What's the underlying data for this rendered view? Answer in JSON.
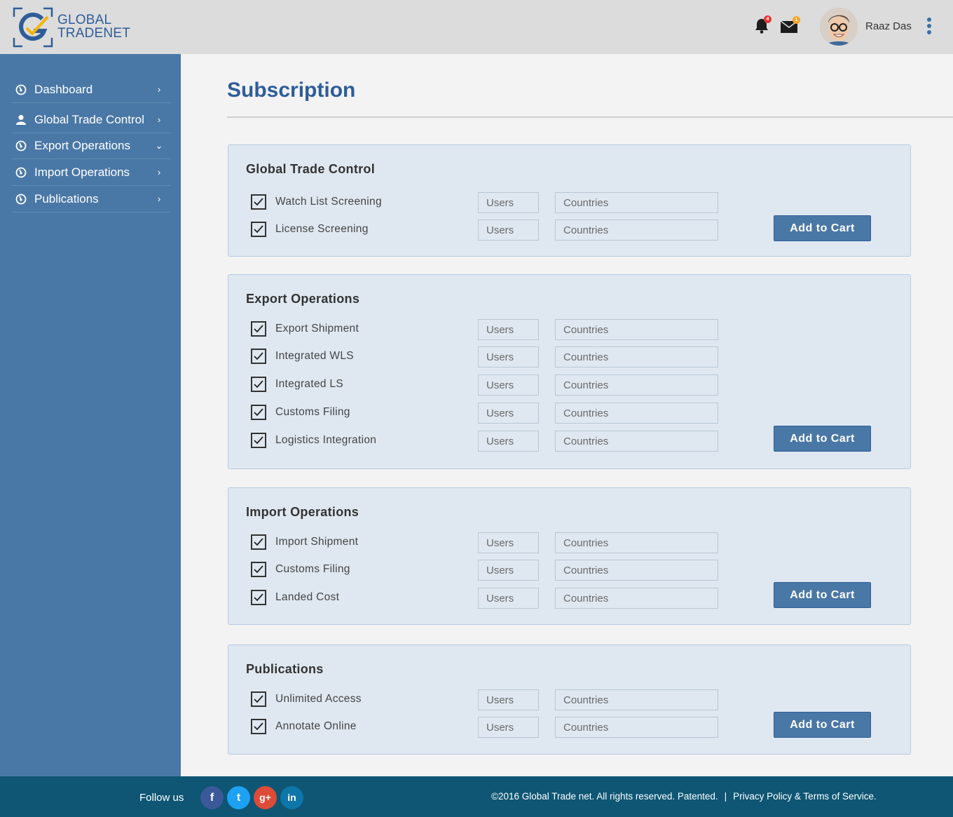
{
  "brand": {
    "line1": "GLOBAL",
    "line2": "TRADENET"
  },
  "header": {
    "notifications": {
      "icon": "bell-icon",
      "count": "4",
      "badge_color": "#e53935"
    },
    "messages": {
      "icon": "mail-icon",
      "count": "1",
      "badge_color": "#f5a623"
    },
    "user_name": "Raaz Das"
  },
  "sidebar": {
    "items": [
      {
        "label": "Dashboard",
        "icon": "dashboard-icon",
        "chevron": "›"
      },
      {
        "label": "Global Trade Control",
        "icon": "user-icon",
        "chevron": "›"
      },
      {
        "label": "Export Operations",
        "icon": "export-icon",
        "chevron": "⌄"
      },
      {
        "label": "Import Operations",
        "icon": "import-icon",
        "chevron": "›"
      },
      {
        "label": "Publications",
        "icon": "publications-icon",
        "chevron": "›"
      }
    ]
  },
  "page": {
    "title": "Subscription"
  },
  "placeholders": {
    "users": "Users",
    "countries": "Countries"
  },
  "sections": {
    "gtc": {
      "title": "Global Trade Control",
      "items": [
        {
          "label": "Watch List Screening",
          "checked": true
        },
        {
          "label": "License Screening",
          "checked": true
        }
      ],
      "button": "Add to Cart"
    },
    "export": {
      "title": "Export Operations",
      "items": [
        {
          "label": "Export Shipment",
          "checked": true
        },
        {
          "label": "Integrated WLS",
          "checked": true
        },
        {
          "label": "Integrated LS",
          "checked": true
        },
        {
          "label": "Customs Filing",
          "checked": true
        },
        {
          "label": "Logistics Integration",
          "checked": true
        }
      ],
      "button": "Add to Cart"
    },
    "import": {
      "title": "Import Operations",
      "items": [
        {
          "label": "Import Shipment",
          "checked": true
        },
        {
          "label": "Customs Filing",
          "checked": true
        },
        {
          "label": "Landed Cost",
          "checked": true
        }
      ],
      "button": "Add to Cart"
    },
    "publications": {
      "title": "Publications",
      "items": [
        {
          "label": "Unlimited Access",
          "checked": true
        },
        {
          "label": "Annotate Online",
          "checked": true
        }
      ],
      "button": "Add to Cart"
    }
  },
  "footer": {
    "follow_label": "Follow us",
    "social": [
      {
        "glyph": "f",
        "icon": "facebook-icon",
        "color": "#3b5998"
      },
      {
        "glyph": "t",
        "icon": "twitter-icon",
        "color": "#1da1f2"
      },
      {
        "glyph": "g+",
        "icon": "google-plus-icon",
        "color": "#dd4b39"
      },
      {
        "glyph": "in",
        "icon": "linkedin-icon",
        "color": "#0e76a8"
      }
    ],
    "copyright": "©2016 Global Trade net. All rights reserved. Patented.",
    "separator": "|",
    "policy_link": "Privacy Policy & Terms of Service."
  }
}
